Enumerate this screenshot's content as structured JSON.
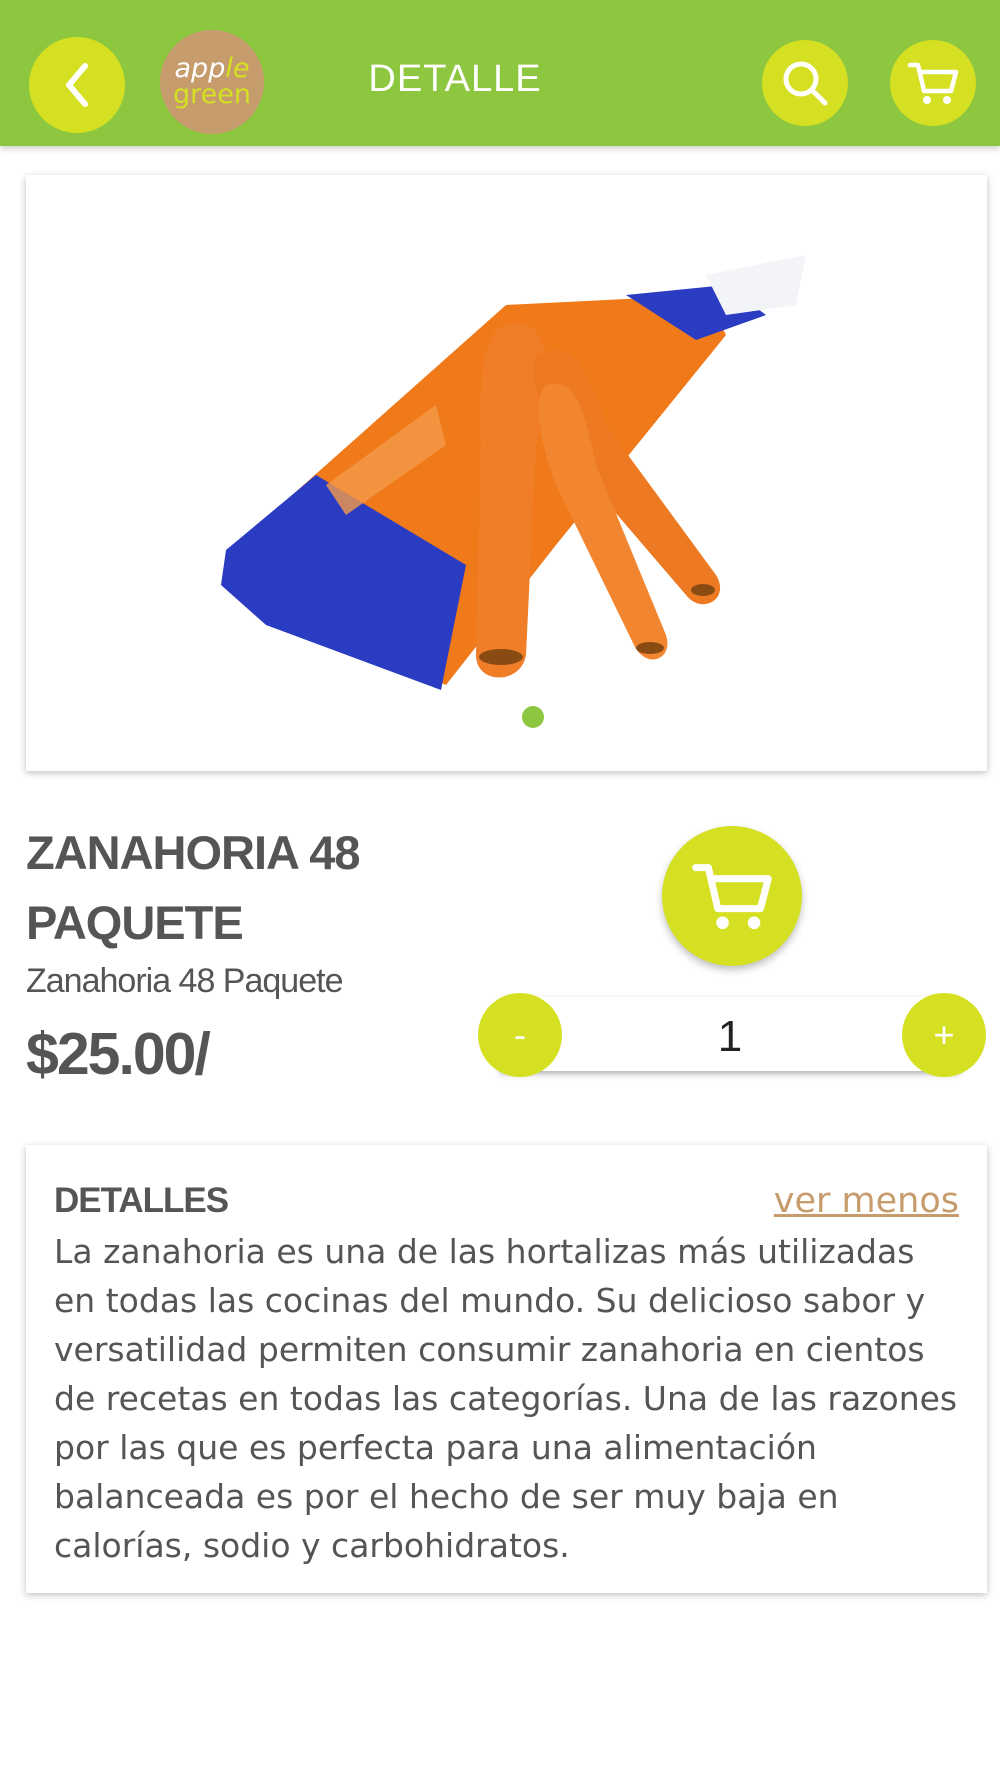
{
  "header": {
    "title": "DETALLE",
    "logo": {
      "line1_part1": "app",
      "line1_part2": "le",
      "line2": "green"
    },
    "back_icon": "chevron-left-icon",
    "search_icon": "search-icon",
    "cart_icon": "cart-icon"
  },
  "product": {
    "image_icon": "carrot-bag-image",
    "carousel_dots": 1,
    "title": "ZANAHORIA 48 PAQUETE",
    "subtitle": "Zanahoria 48 Paquete",
    "price": "$25.00/",
    "add_to_cart_icon": "cart-icon",
    "quantity": {
      "minus": "-",
      "value": "1",
      "plus": "+"
    }
  },
  "details": {
    "title": "DETALLES",
    "toggle": "ver menos",
    "text": "La zanahoria es una de las hortalizas más utilizadas en todas las cocinas del mundo. Su delicioso sabor y versatilidad permiten consumir zanahoria en cientos de recetas en todas las categorías. Una de las razones por las que es perfecta para una alimentación balanceada es por el hecho de ser muy baja en calorías, sodio y carbohidratos."
  },
  "colors": {
    "header_green": "#8dc63f",
    "accent_lime": "#d4e021",
    "logo_tan": "#c69c6d",
    "text_gray": "#555555",
    "link_tan": "#c69c6d"
  }
}
